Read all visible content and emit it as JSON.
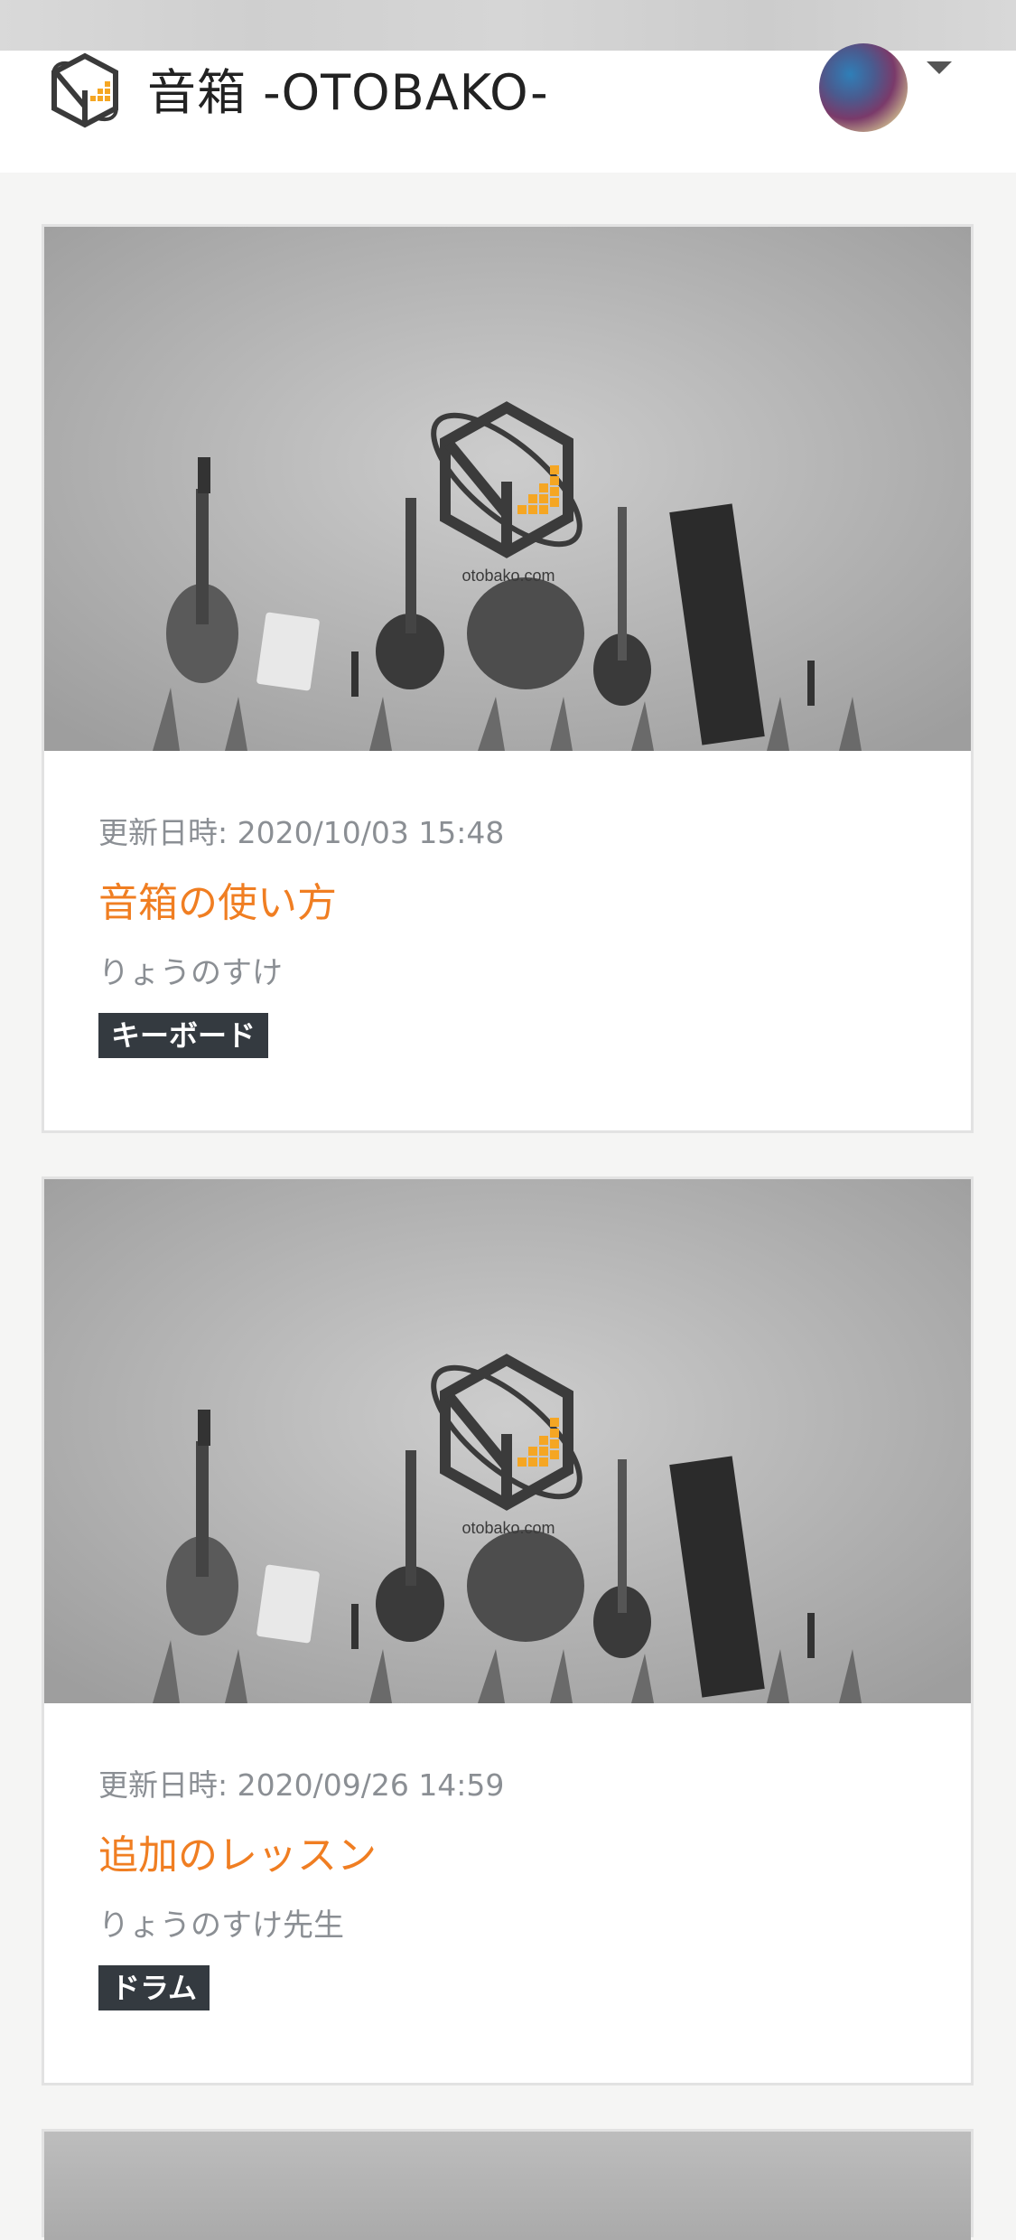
{
  "app": {
    "title": "音箱 -OTOBAKO-"
  },
  "cards": [
    {
      "updated_label": "更新日時:",
      "updated_at": "2020/10/03 15:48",
      "title": "音箱の使い方",
      "author": "りょうのすけ",
      "tag": "キーボード",
      "image_brand": "otobako.com"
    },
    {
      "updated_label": "更新日時:",
      "updated_at": "2020/09/26 14:59",
      "title": "追加のレッスン",
      "author": "りょうのすけ先生",
      "tag": "ドラム",
      "image_brand": "otobako.com"
    }
  ],
  "colors": {
    "accent": "#f07e22",
    "tag_bg": "#343a40",
    "muted_text": "#8b8f94"
  }
}
